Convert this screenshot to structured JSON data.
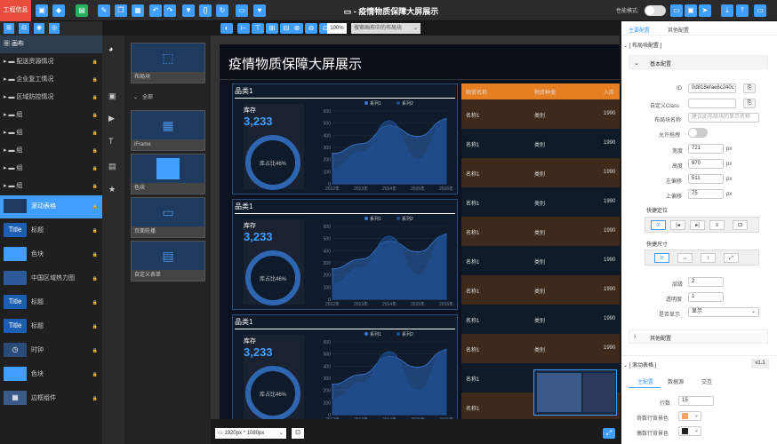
{
  "app": {
    "brand": "工程信息",
    "doc_title": "疫情物质保障大屏展示",
    "perf_label": "性能模式:"
  },
  "layers": {
    "header_label": "画布",
    "items": [
      {
        "label": "配送资源情况",
        "type": "group"
      },
      {
        "label": "企业复工情况",
        "type": "group"
      },
      {
        "label": "区域防控情况",
        "type": "group"
      },
      {
        "label": "组",
        "type": "group"
      },
      {
        "label": "组",
        "type": "group"
      },
      {
        "label": "组",
        "type": "group"
      },
      {
        "label": "组",
        "type": "group"
      },
      {
        "label": "组",
        "type": "group"
      },
      {
        "label": "滚动表格",
        "type": "table",
        "selected": true
      },
      {
        "label": "标题",
        "type": "title"
      },
      {
        "label": "色块",
        "type": "block"
      },
      {
        "label": "中国区域热力图",
        "type": "map"
      },
      {
        "label": "标题",
        "type": "title"
      },
      {
        "label": "标题",
        "type": "title"
      },
      {
        "label": "时钟",
        "type": "clock"
      },
      {
        "label": "色块",
        "type": "block"
      },
      {
        "label": "边框组件",
        "type": "border"
      }
    ]
  },
  "gallery": {
    "first_label": "布局块",
    "section_label": "全部",
    "cards": [
      {
        "label": "iFrame"
      },
      {
        "label": "色块"
      },
      {
        "label": "页面轮播"
      },
      {
        "label": "自定义表单"
      }
    ]
  },
  "canvas_toolbar": {
    "zoom": "100%",
    "search_placeholder": "搜索画布中的布局块"
  },
  "screen": {
    "title": "疫情物质保障大屏展示",
    "panels": [
      {
        "title": "品类1",
        "stock_label": "库存",
        "stock_value": "3,233",
        "ring_label": "库占比46%"
      },
      {
        "title": "品类1",
        "stock_label": "库存",
        "stock_value": "3,233",
        "ring_label": "库占比46%"
      },
      {
        "title": "品类1",
        "stock_label": "库存",
        "stock_value": "3,233",
        "ring_label": "库占比46%"
      }
    ],
    "table": {
      "headers": [
        "物资名称",
        "物资种类",
        "入库"
      ],
      "rows": [
        [
          "名称1",
          "类别",
          "1990"
        ],
        [
          "名称1",
          "类别",
          "1990"
        ],
        [
          "名称1",
          "类别",
          "1990"
        ],
        [
          "名称1",
          "类别",
          "1990"
        ],
        [
          "名称1",
          "类别",
          "1990"
        ],
        [
          "名称1",
          "类别",
          "1990"
        ],
        [
          "名称1",
          "类别",
          "1990"
        ],
        [
          "名称1",
          "类别",
          "1990"
        ],
        [
          "名称1",
          "类别",
          "1990"
        ],
        [
          "名称1",
          "类别",
          "1990"
        ],
        [
          "名称1",
          "类别",
          "1990"
        ]
      ]
    }
  },
  "chart_data": [
    {
      "type": "area",
      "categories": [
        "2012年",
        "2013年",
        "2014年",
        "2015年",
        "2016年"
      ],
      "ylim": [
        0,
        600
      ],
      "yticks": [
        0,
        100,
        200,
        300,
        400,
        500,
        600
      ],
      "series": [
        {
          "name": "系列1",
          "values": [
            250,
            330,
            480,
            390,
            530
          ]
        },
        {
          "name": "系列2",
          "values": [
            130,
            260,
            520,
            200,
            540
          ]
        }
      ]
    },
    {
      "type": "area",
      "categories": [
        "2012年",
        "2013年",
        "2014年",
        "2015年",
        "2016年"
      ],
      "ylim": [
        0,
        600
      ],
      "yticks": [
        0,
        100,
        200,
        300,
        400,
        500,
        600
      ],
      "series": [
        {
          "name": "系列1",
          "values": [
            250,
            330,
            480,
            390,
            530
          ]
        },
        {
          "name": "系列2",
          "values": [
            130,
            260,
            520,
            200,
            540
          ]
        }
      ]
    },
    {
      "type": "area",
      "categories": [
        "2012年",
        "2013年",
        "2014年",
        "2015年",
        "2016年"
      ],
      "ylim": [
        0,
        600
      ],
      "yticks": [
        0,
        100,
        200,
        300,
        400,
        500,
        600
      ],
      "series": [
        {
          "name": "系列1",
          "values": [
            250,
            330,
            480,
            390,
            530
          ]
        },
        {
          "name": "系列2",
          "values": [
            130,
            260,
            520,
            200,
            540
          ]
        }
      ]
    }
  ],
  "bottom": {
    "resolution": "1920px * 1080px"
  },
  "props": {
    "tabs": [
      "主要配置",
      "其他配置"
    ],
    "section1": "[ 布局块配置 ]",
    "basic": "基本配置",
    "id_label": "ID",
    "id_value": "0d818efae6c240c",
    "class_label": "自定义Class",
    "class_placeholder": "",
    "name_label": "布局块名称",
    "name_placeholder": "建议此布局块的显示名称",
    "drag_label": "允许拖拽",
    "width_label": "宽度",
    "width_value": "721",
    "height_label": "高度",
    "height_value": "970",
    "left_label": "左偏移",
    "left_value": "511",
    "top_label": "上偏移",
    "top_value": "75",
    "unit": "px",
    "quick_pos": "快捷定位",
    "quick_size": "快捷尺寸",
    "layer_label": "层级",
    "layer_value": "2",
    "opacity_label": "透明度",
    "opacity_value": "1",
    "show_label": "是否显示",
    "show_value": "显示",
    "other": "其他配置",
    "section2": "[ 滚动表格 ]",
    "version": "v1.1",
    "sub_tabs": [
      "主配置",
      "数据源",
      "交互"
    ],
    "rows_label": "行数",
    "rows_value": "15",
    "odd_label": "奇数行背景色",
    "even_label": "偶数行背景色"
  }
}
